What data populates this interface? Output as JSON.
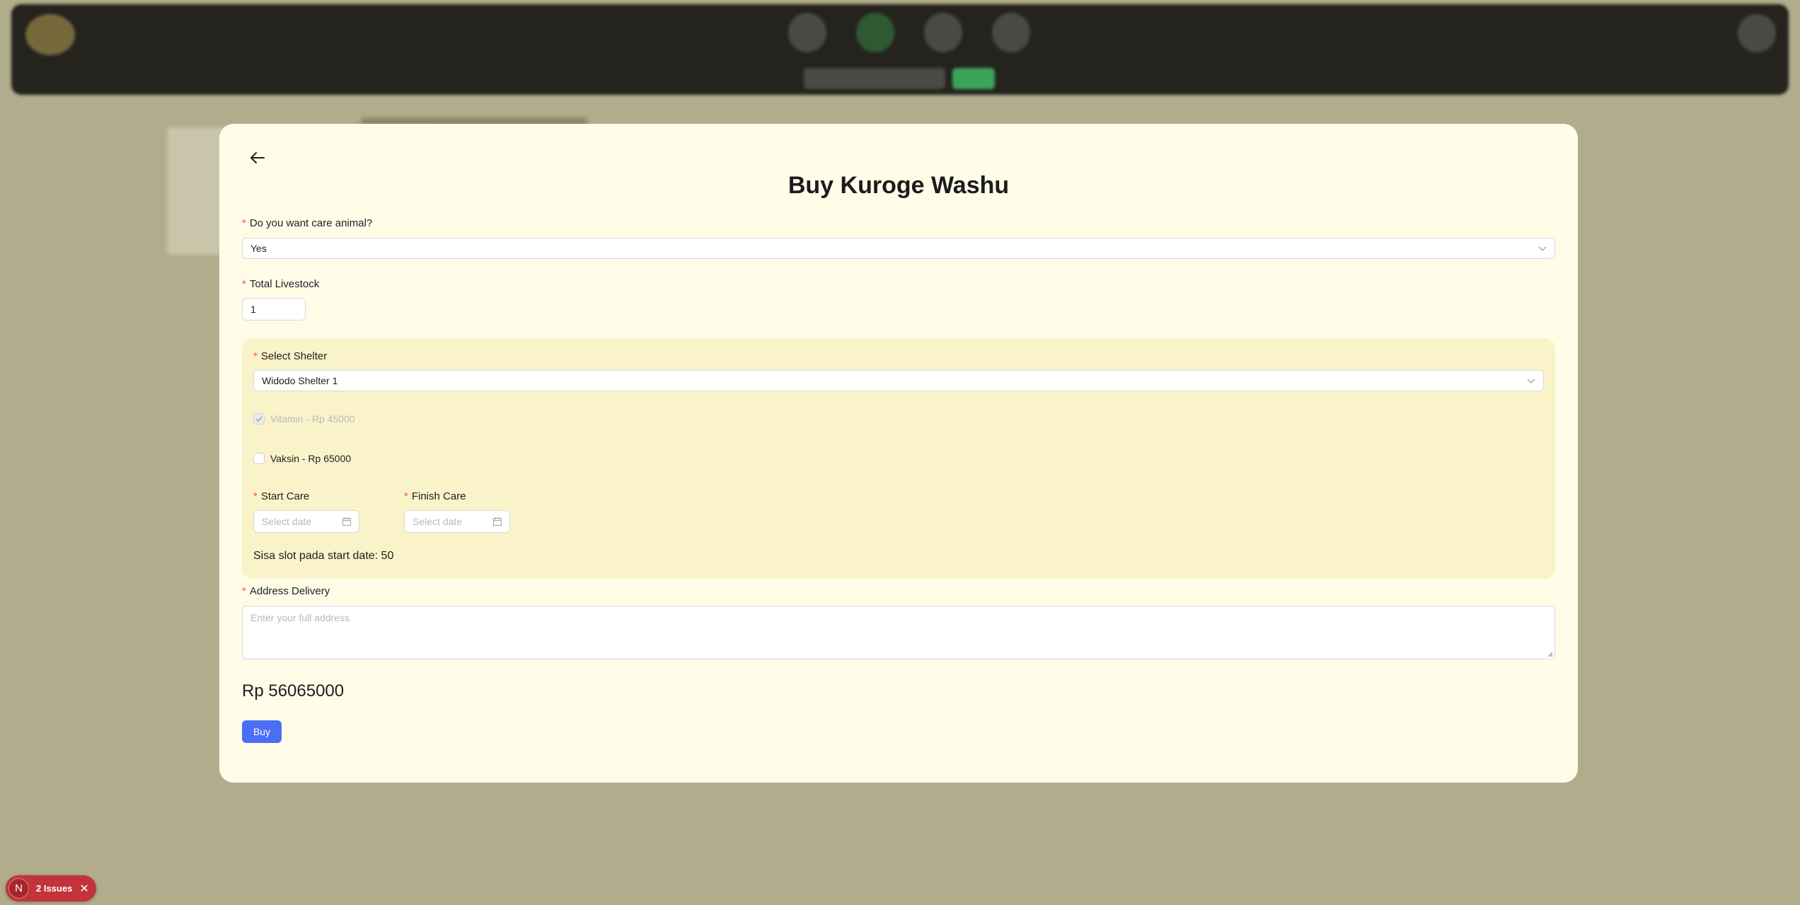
{
  "modal": {
    "title": "Buy Kuroge Washu",
    "care_question": {
      "label": "Do you want care animal?",
      "value": "Yes"
    },
    "total_livestock": {
      "label": "Total Livestock",
      "value": "1"
    },
    "shelter": {
      "label": "Select Shelter",
      "value": "Widodo Shelter 1",
      "options": [
        {
          "label": "Vitamin - Rp 45000",
          "checked": true,
          "disabled": true
        },
        {
          "label": "Vaksin - Rp 65000",
          "checked": false,
          "disabled": false
        }
      ],
      "start_care": {
        "label": "Start Care",
        "placeholder": "Select date"
      },
      "finish_care": {
        "label": "Finish Care",
        "placeholder": "Select date"
      },
      "slot_text": "Sisa slot pada start date: 50"
    },
    "address": {
      "label": "Address Delivery",
      "placeholder": "Enter your full address"
    },
    "total_price": "Rp 56065000",
    "buy_label": "Buy"
  },
  "issues_badge": {
    "logo": "N",
    "text": "2 Issues"
  },
  "colors": {
    "primary": "#4b6ef5",
    "required": "#ff4d4f",
    "modal_bg": "#fffde8",
    "panel_bg": "#faf3c9"
  }
}
